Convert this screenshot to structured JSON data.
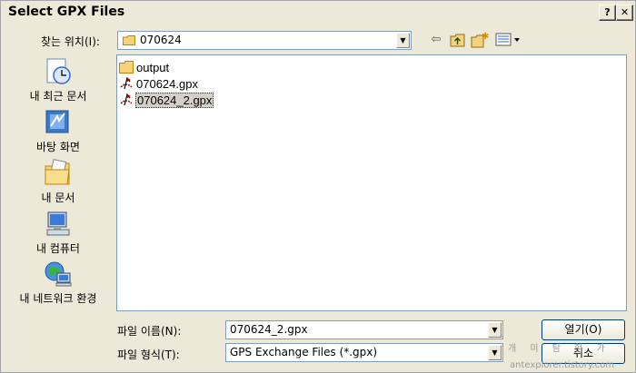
{
  "window": {
    "title": "Select GPX Files",
    "help_btn": "?",
    "close_btn": "✕"
  },
  "lookin": {
    "label": "찾는 위치(I):",
    "value": "070624"
  },
  "places": [
    {
      "label": "내 최근 문서"
    },
    {
      "label": "바탕 화면"
    },
    {
      "label": "내 문서"
    },
    {
      "label": "내 컴퓨터"
    },
    {
      "label": "내 네트워크 환경"
    }
  ],
  "files": [
    {
      "name": "output",
      "type": "folder"
    },
    {
      "name": "070624.gpx",
      "type": "gpx"
    },
    {
      "name": "070624_2.gpx",
      "type": "gpx",
      "selected": true
    }
  ],
  "filename": {
    "label": "파일 이름(N):",
    "value": "070624_2.gpx"
  },
  "filetype": {
    "label": "파일 형식(T):",
    "value": "GPS Exchange Files (*.gpx)"
  },
  "buttons": {
    "open": "열기(O)",
    "cancel": "취소"
  },
  "watermark": {
    "text": "antexplorer.tistory.com",
    "overlay": "개 미 탐 험 가"
  }
}
